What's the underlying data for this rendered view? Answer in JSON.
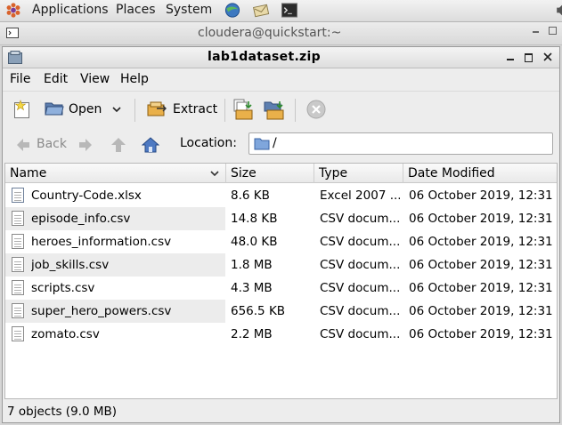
{
  "panel": {
    "menus": [
      "Applications",
      "Places",
      "System"
    ],
    "icons": [
      "app-logo-icon",
      "browser-icon",
      "mail-icon",
      "terminal-icon",
      "volume-icon"
    ]
  },
  "terminal": {
    "title": "cloudera@quickstart:~"
  },
  "window": {
    "title": "lab1dataset.zip",
    "menus": [
      "File",
      "Edit",
      "View",
      "Help"
    ],
    "toolbar": {
      "open_label": "Open",
      "extract_label": "Extract"
    },
    "location": {
      "back_label": "Back",
      "label": "Location:",
      "value": "/"
    },
    "columns": [
      "Name",
      "Size",
      "Type",
      "Date Modified"
    ],
    "files": [
      {
        "name": "Country-Code.xlsx",
        "size": "8.6 KB",
        "type": "Excel 2007 ...",
        "date": "06 October 2019, 12:31"
      },
      {
        "name": "episode_info.csv",
        "size": "14.8 KB",
        "type": "CSV docum...",
        "date": "06 October 2019, 12:31"
      },
      {
        "name": "heroes_information.csv",
        "size": "48.0 KB",
        "type": "CSV docum...",
        "date": "06 October 2019, 12:31"
      },
      {
        "name": "job_skills.csv",
        "size": "1.8 MB",
        "type": "CSV docum...",
        "date": "06 October 2019, 12:31"
      },
      {
        "name": "scripts.csv",
        "size": "4.3 MB",
        "type": "CSV docum...",
        "date": "06 October 2019, 12:31"
      },
      {
        "name": "super_hero_powers.csv",
        "size": "656.5 KB",
        "type": "CSV docum...",
        "date": "06 October 2019, 12:31"
      },
      {
        "name": "zomato.csv",
        "size": "2.2 MB",
        "type": "CSV docum...",
        "date": "06 October 2019, 12:31"
      }
    ],
    "status": "7 objects (9.0 MB)"
  }
}
